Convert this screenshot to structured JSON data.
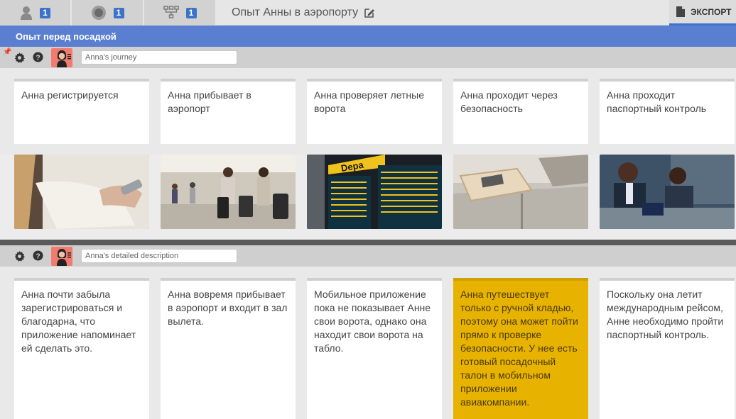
{
  "topbar": {
    "persona_count": "1",
    "channel_count": "1",
    "process_count": "1",
    "title": "Опыт Анны в аэропорту",
    "export_label": "ЭКСПОРТ"
  },
  "stage": {
    "title": "Опыт перед посадкой"
  },
  "lane1": {
    "input_value": "Anna's journey",
    "cards": [
      "Анна регистрируется",
      "Анна прибывает в аэропорт",
      "Анна проверяет летные ворота",
      "Анна проходит через безопасность",
      "Анна проходит паспортный контроль"
    ]
  },
  "images": [
    {
      "name": "checkin-photo"
    },
    {
      "name": "airport-walking-photo"
    },
    {
      "name": "departure-board-photo"
    },
    {
      "name": "security-tray-photo"
    },
    {
      "name": "passport-control-photo"
    }
  ],
  "lane2": {
    "input_value": "Anna's detailed description",
    "cards": [
      "Анна почти забыла зарегистрироваться и благодарна, что приложение напоминает ей сделать это.",
      "Анна вовремя прибывает в аэропорт и входит в зал вылета.",
      "Мобильное приложение пока не показывает Анне свои ворота, однако она находит свои ворота на табло.",
      "Анна путешествует только с ручной кладью, поэтому она может пойти прямо к проверке безопасности. У нее есть готовый посадочный талон в мобильном приложении авиакомпании.",
      "Поскольку она летит международным рейсом, Анне необходимо пройти паспортный контроль."
    ],
    "highlight_color": "#e8b300"
  },
  "colors": {
    "accent": "#3b73c8",
    "stage": "#5b7fd0",
    "avatar": "#f07b6e"
  }
}
